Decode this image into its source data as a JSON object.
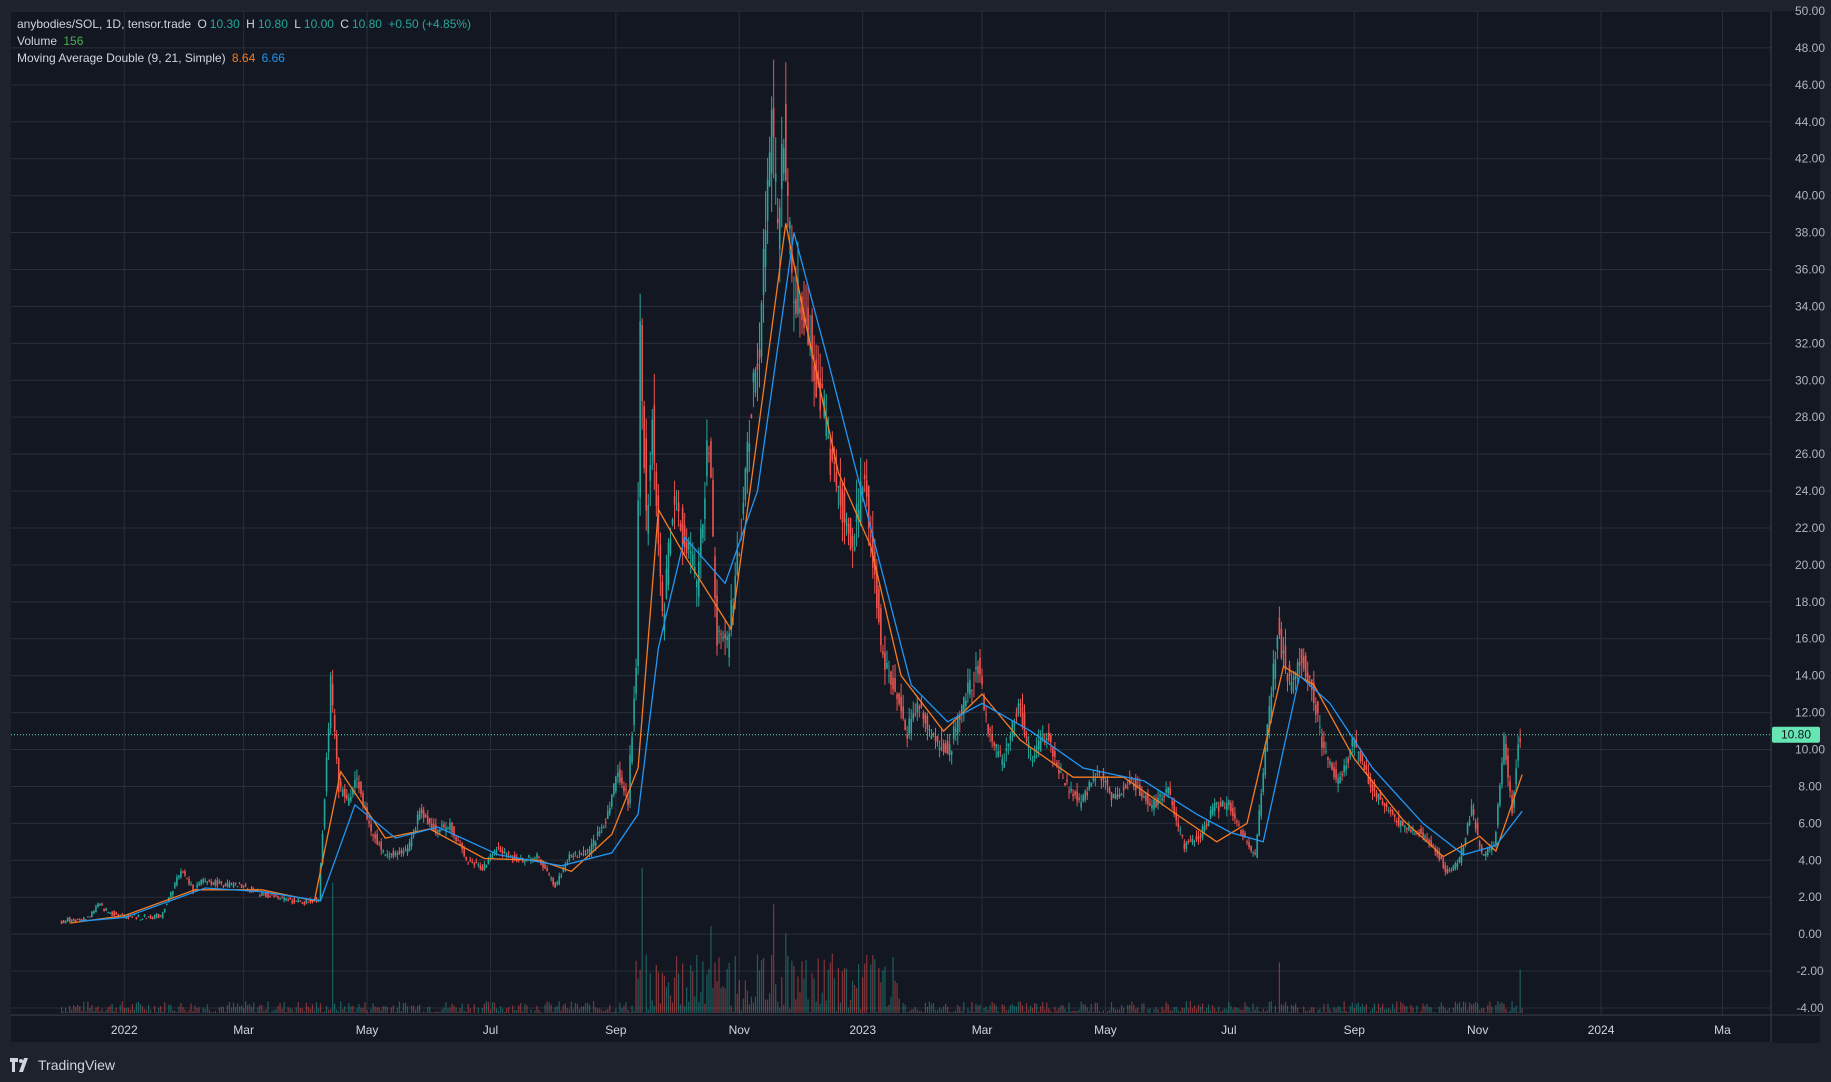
{
  "header": {
    "symbol": "anybodies/SOL, 1D, tensor.trade",
    "open_label": "O",
    "open": "10.30",
    "high_label": "H",
    "high": "10.80",
    "low_label": "L",
    "low": "10.00",
    "close_label": "C",
    "close": "10.80",
    "change": "+0.50 (+4.85%)",
    "volume_label": "Volume",
    "volume": "156",
    "ma_label": "Moving Average Double (9, 21, Simple)",
    "ma_fast": "8.64",
    "ma_slow": "6.66"
  },
  "footer": {
    "brand": "TradingView"
  },
  "colors": {
    "up": "#26a69a",
    "down": "#ef5350",
    "ma_fast": "#f57c23",
    "ma_slow": "#2196f3",
    "last_price_bg": "#66e6b2"
  },
  "chart_data": {
    "type": "candlestick",
    "title": "anybodies/SOL, 1D, tensor.trade",
    "current_price": 10.8,
    "current_price_label": "10.80",
    "ylim": [
      -4,
      50
    ],
    "y_ticks": [
      "50.00",
      "48.00",
      "46.00",
      "44.00",
      "42.00",
      "40.00",
      "38.00",
      "36.00",
      "34.00",
      "32.00",
      "30.00",
      "28.00",
      "26.00",
      "24.00",
      "22.00",
      "20.00",
      "18.00",
      "16.00",
      "14.00",
      "12.00",
      "10.00",
      "8.00",
      "6.00",
      "4.00",
      "2.00",
      "0.00",
      "-2.00",
      "-4.00"
    ],
    "x_range": [
      "2021-11-06",
      "2024-03-25"
    ],
    "x_ticks": [
      {
        "label": "2022",
        "date": "2022-01-01"
      },
      {
        "label": "Mar",
        "date": "2022-03-01"
      },
      {
        "label": "May",
        "date": "2022-05-01"
      },
      {
        "label": "Jul",
        "date": "2022-07-01"
      },
      {
        "label": "Sep",
        "date": "2022-09-01"
      },
      {
        "label": "Nov",
        "date": "2022-11-01"
      },
      {
        "label": "2023",
        "date": "2023-01-01"
      },
      {
        "label": "Mar",
        "date": "2023-03-01"
      },
      {
        "label": "May",
        "date": "2023-05-01"
      },
      {
        "label": "Jul",
        "date": "2023-07-01"
      },
      {
        "label": "Sep",
        "date": "2023-09-01"
      },
      {
        "label": "Nov",
        "date": "2023-11-01"
      },
      {
        "label": "2024",
        "date": "2024-01-01"
      },
      {
        "label": "Ma",
        "date": "2024-03-01"
      }
    ],
    "price_series": {
      "name": "close",
      "points": [
        [
          "2021-12-01",
          0.6
        ],
        [
          "2021-12-05",
          0.8
        ],
        [
          "2021-12-10",
          0.7
        ],
        [
          "2021-12-15",
          0.9
        ],
        [
          "2021-12-20",
          1.6
        ],
        [
          "2021-12-25",
          1.2
        ],
        [
          "2021-12-31",
          1.0
        ],
        [
          "2022-01-10",
          0.9
        ],
        [
          "2022-01-20",
          1.0
        ],
        [
          "2022-01-25",
          2.2
        ],
        [
          "2022-01-30",
          3.5
        ],
        [
          "2022-02-05",
          2.4
        ],
        [
          "2022-02-10",
          2.9
        ],
        [
          "2022-02-20",
          2.7
        ],
        [
          "2022-03-01",
          2.6
        ],
        [
          "2022-03-10",
          2.2
        ],
        [
          "2022-03-20",
          1.9
        ],
        [
          "2022-04-01",
          1.7
        ],
        [
          "2022-04-08",
          1.9
        ],
        [
          "2022-04-12",
          9.5
        ],
        [
          "2022-04-14",
          13.5
        ],
        [
          "2022-04-18",
          8.0
        ],
        [
          "2022-04-22",
          7.2
        ],
        [
          "2022-04-27",
          8.5
        ],
        [
          "2022-05-03",
          5.8
        ],
        [
          "2022-05-10",
          4.4
        ],
        [
          "2022-05-16",
          4.3
        ],
        [
          "2022-05-22",
          4.6
        ],
        [
          "2022-05-28",
          6.6
        ],
        [
          "2022-06-05",
          5.6
        ],
        [
          "2022-06-12",
          5.9
        ],
        [
          "2022-06-20",
          4.0
        ],
        [
          "2022-06-28",
          3.6
        ],
        [
          "2022-07-05",
          4.6
        ],
        [
          "2022-07-15",
          4.0
        ],
        [
          "2022-07-25",
          4.2
        ],
        [
          "2022-08-03",
          2.6
        ],
        [
          "2022-08-10",
          4.2
        ],
        [
          "2022-08-20",
          4.5
        ],
        [
          "2022-08-28",
          6.2
        ],
        [
          "2022-09-03",
          8.8
        ],
        [
          "2022-09-08",
          7.2
        ],
        [
          "2022-09-12",
          15.0
        ],
        [
          "2022-09-14",
          33.0
        ],
        [
          "2022-09-17",
          22.5
        ],
        [
          "2022-09-20",
          28.0
        ],
        [
          "2022-09-25",
          17.0
        ],
        [
          "2022-09-30",
          23.0
        ],
        [
          "2022-10-05",
          22.0
        ],
        [
          "2022-10-12",
          19.0
        ],
        [
          "2022-10-18",
          27.0
        ],
        [
          "2022-10-22",
          16.0
        ],
        [
          "2022-10-27",
          15.5
        ],
        [
          "2022-11-02",
          21.0
        ],
        [
          "2022-11-08",
          29.0
        ],
        [
          "2022-11-12",
          32.0
        ],
        [
          "2022-11-16",
          40.0
        ],
        [
          "2022-11-18",
          44.5
        ],
        [
          "2022-11-21",
          37.5
        ],
        [
          "2022-11-24",
          44.0
        ],
        [
          "2022-11-28",
          35.0
        ],
        [
          "2022-12-02",
          34.0
        ],
        [
          "2022-12-06",
          33.0
        ],
        [
          "2022-12-10",
          30.0
        ],
        [
          "2022-12-14",
          28.0
        ],
        [
          "2022-12-18",
          25.0
        ],
        [
          "2022-12-23",
          23.0
        ],
        [
          "2022-12-28",
          21.0
        ],
        [
          "2023-01-03",
          25.0
        ],
        [
          "2023-01-07",
          20.0
        ],
        [
          "2023-01-12",
          15.0
        ],
        [
          "2023-01-18",
          13.0
        ],
        [
          "2023-01-24",
          11.0
        ],
        [
          "2023-01-30",
          12.5
        ],
        [
          "2023-02-06",
          10.5
        ],
        [
          "2023-02-14",
          10.0
        ],
        [
          "2023-02-20",
          12.3
        ],
        [
          "2023-02-28",
          14.5
        ],
        [
          "2023-03-05",
          11.0
        ],
        [
          "2023-03-12",
          9.3
        ],
        [
          "2023-03-20",
          12.5
        ],
        [
          "2023-03-26",
          9.5
        ],
        [
          "2023-04-03",
          10.8
        ],
        [
          "2023-04-10",
          8.5
        ],
        [
          "2023-04-20",
          7.0
        ],
        [
          "2023-04-28",
          8.9
        ],
        [
          "2023-05-05",
          7.5
        ],
        [
          "2023-05-15",
          8.3
        ],
        [
          "2023-05-25",
          6.9
        ],
        [
          "2023-06-02",
          7.8
        ],
        [
          "2023-06-10",
          4.8
        ],
        [
          "2023-06-18",
          5.4
        ],
        [
          "2023-06-25",
          6.9
        ],
        [
          "2023-07-02",
          7.0
        ],
        [
          "2023-07-08",
          5.6
        ],
        [
          "2023-07-15",
          4.2
        ],
        [
          "2023-07-22",
          12.0
        ],
        [
          "2023-07-26",
          16.5
        ],
        [
          "2023-08-01",
          13.5
        ],
        [
          "2023-08-06",
          15.0
        ],
        [
          "2023-08-12",
          13.5
        ],
        [
          "2023-08-18",
          9.8
        ],
        [
          "2023-08-25",
          8.3
        ],
        [
          "2023-09-02",
          10.5
        ],
        [
          "2023-09-10",
          8.0
        ],
        [
          "2023-09-18",
          6.8
        ],
        [
          "2023-09-26",
          5.8
        ],
        [
          "2023-10-04",
          5.5
        ],
        [
          "2023-10-12",
          4.6
        ],
        [
          "2023-10-18",
          3.3
        ],
        [
          "2023-10-24",
          4.0
        ],
        [
          "2023-10-30",
          6.8
        ],
        [
          "2023-11-04",
          4.3
        ],
        [
          "2023-11-10",
          4.7
        ],
        [
          "2023-11-15",
          10.5
        ],
        [
          "2023-11-19",
          6.8
        ],
        [
          "2023-11-22",
          10.3
        ],
        [
          "2023-11-23",
          10.8
        ]
      ]
    },
    "moving_averages": [
      {
        "name": "MA 9",
        "value": 8.64,
        "points": [
          [
            "2021-12-05",
            0.6
          ],
          [
            "2022-01-01",
            1.0
          ],
          [
            "2022-02-05",
            2.4
          ],
          [
            "2022-03-10",
            2.4
          ],
          [
            "2022-04-05",
            1.8
          ],
          [
            "2022-04-18",
            8.8
          ],
          [
            "2022-05-10",
            5.2
          ],
          [
            "2022-06-01",
            5.7
          ],
          [
            "2022-06-28",
            4.1
          ],
          [
            "2022-07-25",
            4.0
          ],
          [
            "2022-08-10",
            3.4
          ],
          [
            "2022-08-30",
            5.4
          ],
          [
            "2022-09-12",
            9.0
          ],
          [
            "2022-09-22",
            23.0
          ],
          [
            "2022-10-05",
            20.5
          ],
          [
            "2022-10-28",
            16.5
          ],
          [
            "2022-11-10",
            27.0
          ],
          [
            "2022-11-24",
            38.5
          ],
          [
            "2022-12-04",
            33.0
          ],
          [
            "2022-12-20",
            25.0
          ],
          [
            "2023-01-05",
            21.0
          ],
          [
            "2023-01-20",
            14.0
          ],
          [
            "2023-02-10",
            11.0
          ],
          [
            "2023-03-01",
            13.0
          ],
          [
            "2023-03-20",
            10.5
          ],
          [
            "2023-04-15",
            8.5
          ],
          [
            "2023-05-10",
            8.5
          ],
          [
            "2023-06-05",
            6.5
          ],
          [
            "2023-06-25",
            5.0
          ],
          [
            "2023-07-10",
            6.0
          ],
          [
            "2023-07-28",
            14.5
          ],
          [
            "2023-08-12",
            13.5
          ],
          [
            "2023-09-01",
            9.5
          ],
          [
            "2023-09-25",
            6.2
          ],
          [
            "2023-10-15",
            4.2
          ],
          [
            "2023-11-02",
            5.3
          ],
          [
            "2023-11-10",
            4.5
          ],
          [
            "2023-11-23",
            8.64
          ]
        ]
      },
      {
        "name": "MA 21",
        "value": 6.66,
        "points": [
          [
            "2021-12-10",
            0.7
          ],
          [
            "2022-01-01",
            0.9
          ],
          [
            "2022-02-10",
            2.5
          ],
          [
            "2022-03-10",
            2.3
          ],
          [
            "2022-04-08",
            1.8
          ],
          [
            "2022-04-25",
            7.0
          ],
          [
            "2022-05-15",
            5.2
          ],
          [
            "2022-06-05",
            5.8
          ],
          [
            "2022-07-05",
            4.3
          ],
          [
            "2022-08-05",
            3.7
          ],
          [
            "2022-08-30",
            4.4
          ],
          [
            "2022-09-12",
            6.5
          ],
          [
            "2022-09-22",
            15.5
          ],
          [
            "2022-10-05",
            21.5
          ],
          [
            "2022-10-25",
            19.0
          ],
          [
            "2022-11-10",
            24.0
          ],
          [
            "2022-11-28",
            38.0
          ],
          [
            "2022-12-15",
            31.0
          ],
          [
            "2023-01-05",
            22.0
          ],
          [
            "2023-01-25",
            13.5
          ],
          [
            "2023-02-12",
            11.5
          ],
          [
            "2023-03-01",
            12.5
          ],
          [
            "2023-03-25",
            11.0
          ],
          [
            "2023-04-20",
            9.0
          ],
          [
            "2023-05-20",
            8.3
          ],
          [
            "2023-06-15",
            6.5
          ],
          [
            "2023-07-02",
            5.5
          ],
          [
            "2023-07-18",
            5.0
          ],
          [
            "2023-08-05",
            14.0
          ],
          [
            "2023-08-20",
            12.5
          ],
          [
            "2023-09-10",
            9.0
          ],
          [
            "2023-10-05",
            6.0
          ],
          [
            "2023-10-25",
            4.3
          ],
          [
            "2023-11-10",
            4.8
          ],
          [
            "2023-11-23",
            6.66
          ]
        ]
      }
    ],
    "volume_bars": {
      "description_unit": "volume",
      "points": [
        [
          "2022-04-14",
          0.9
        ],
        [
          "2022-09-14",
          1.0
        ],
        [
          "2022-11-18",
          0.75
        ],
        [
          "2022-11-24",
          0.55
        ],
        [
          "2023-07-26",
          0.35
        ],
        [
          "2023-11-22",
          0.3
        ],
        [
          "2023-01-03",
          0.4
        ],
        [
          "2022-10-18",
          0.6
        ]
      ]
    }
  }
}
